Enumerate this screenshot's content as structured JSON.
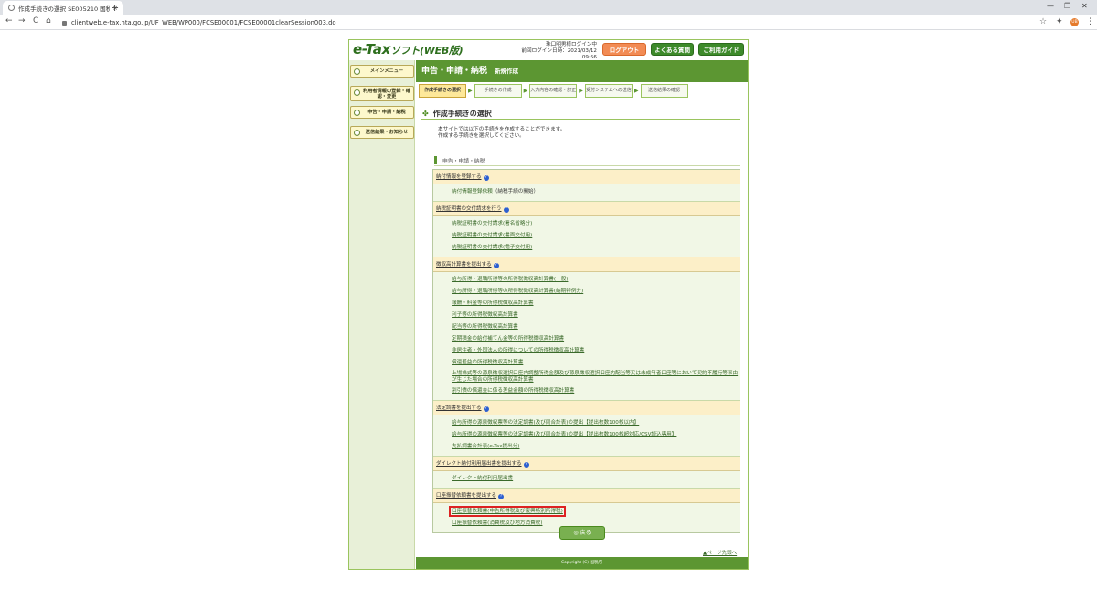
{
  "browser": {
    "tab_title": "作成手続きの選択 SE005210 国税",
    "tab_close": "×",
    "new_tab": "+",
    "url": "clientweb.e-tax.nta.go.jp/UF_WEB/WP000/FCSE00001/FCSE00001clearSession003.do",
    "back": "←",
    "forward": "→",
    "reload": "C",
    "home": "⌂",
    "min": "—",
    "restore": "❐",
    "close": "✕",
    "star": "☆",
    "extensions": "✦",
    "profile": "☰",
    "menu": "⋮",
    "avatar_text": "UB"
  },
  "header": {
    "logo_main": "e-Tax",
    "logo_sub": "ソフト(WEB版)",
    "user_line1": "珠口明男様ログイン中",
    "user_line2": "前回ログイン日時：2021/03/12 09:56",
    "logout": "ログアウト",
    "faq": "よくある質問",
    "guide": "ご利用ガイド"
  },
  "sidebar": {
    "items": [
      {
        "label": "メインメニュー"
      },
      {
        "label": "利用者情報の登録・確認・変更"
      },
      {
        "label": "申告・申請・納税"
      },
      {
        "label": "送信結果・お知らせ"
      }
    ]
  },
  "main": {
    "title": "申告・申請・納税",
    "subtitle": "新規作成",
    "steps": [
      "作成手続きの選択",
      "手続きの作成",
      "入力内容の確認・訂正",
      "受付システムへの送信",
      "送信結果の確認"
    ],
    "section_title": "作成手続きの選択",
    "intro_line1": "本サイトでは以下の手続きを作成することができます。",
    "intro_line2": "作成する手続きを選択してください。",
    "category": "申告・申請・納税",
    "groups": [
      {
        "title": "納付情報を登録する",
        "links": [
          "納付情報登録依頼"
        ],
        "note": "（納税手続の開始）"
      },
      {
        "title": "納税証明書の交付請求を行う",
        "links": [
          "納税証明書の交付請求(署名省略分)",
          "納税証明書の交付請求(書面交付用)",
          "納税証明書の交付請求(電子交付用)"
        ]
      },
      {
        "title": "徴収高計算書を提出する",
        "links": [
          "給与所得・退職所得等の所得税徴収高計算書(一般)",
          "給与所得・退職所得等の所得税徴収高計算書(納期特例分)",
          "報酬・料金等の所得税徴収高計算書",
          "利子等の所得税徴収高計算書",
          "配当等の所得税徴収高計算書",
          "定期積金の給付補てん金等の所得税徴収高計算書",
          "非居住者・外国法人の所得についての所得税徴収高計算書",
          "償還差益の所得税徴収高計算書",
          "上場株式等の源泉徴収選択口座内調整所得金額及び源泉徴収選択口座内配当等又は未成年者口座等において契約不履行等事由が生じた場合の所得税徴収高計算書",
          "割引債の償還金に係る差益金額の所得税徴収高計算書"
        ]
      },
      {
        "title": "法定調書を提出する",
        "links": [
          "給与所得の源泉徴収票等の法定調書(及び同合計表)の提出【提出枚数100枚以内】",
          "給与所得の源泉徴収票等の法定調書(及び同合計表)の提出【提出枚数100枚超対応/CSV読込専用】",
          "支払調書合計表(e-Tax提出分)"
        ]
      },
      {
        "title": "ダイレクト納付利用届出書を提出する",
        "links": [
          "ダイレクト納付利用届出書"
        ]
      },
      {
        "title": "口座振替依頼書を提出する",
        "links": [
          "口座振替依頼書(申告所得税及び復興特別所得税)",
          "口座振替依頼書(消費税及び地方消費税)"
        ]
      }
    ],
    "back_button": "◎ 戻る",
    "page_top": "▲ページ先頭へ",
    "footer": "Copyright (C) 国税庁"
  }
}
